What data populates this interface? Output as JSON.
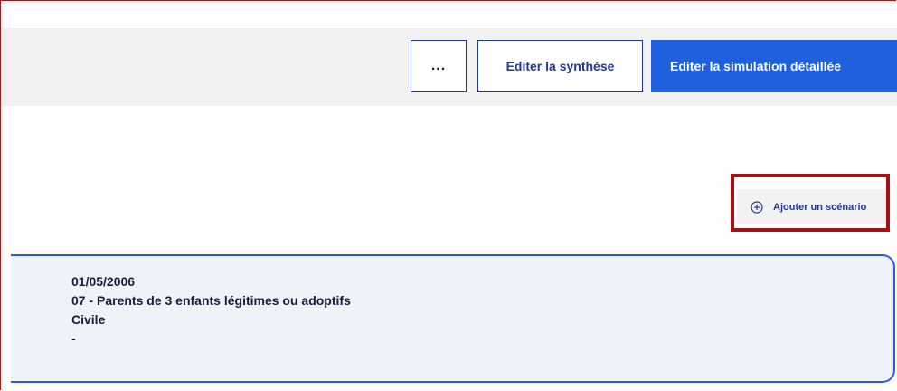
{
  "toolbar": {
    "more_label": "...",
    "edit_synthese_label": "Editer la synthèse",
    "edit_detaillee_label": "Editer la simulation détaillée"
  },
  "scenario": {
    "add_label": "Ajouter un scénario",
    "icon": "plus-circle-icon"
  },
  "card": {
    "date": "01/05/2006",
    "category": "07 - Parents de 3 enfants légitimes ou adoptifs",
    "type": "Civile",
    "extra": "-"
  },
  "colors": {
    "primary": "#1f5fe0",
    "navy": "#1f3a93",
    "highlight": "#a81111",
    "toolbar_bg": "#f2f2f2",
    "card_bg": "#eef3fa"
  }
}
